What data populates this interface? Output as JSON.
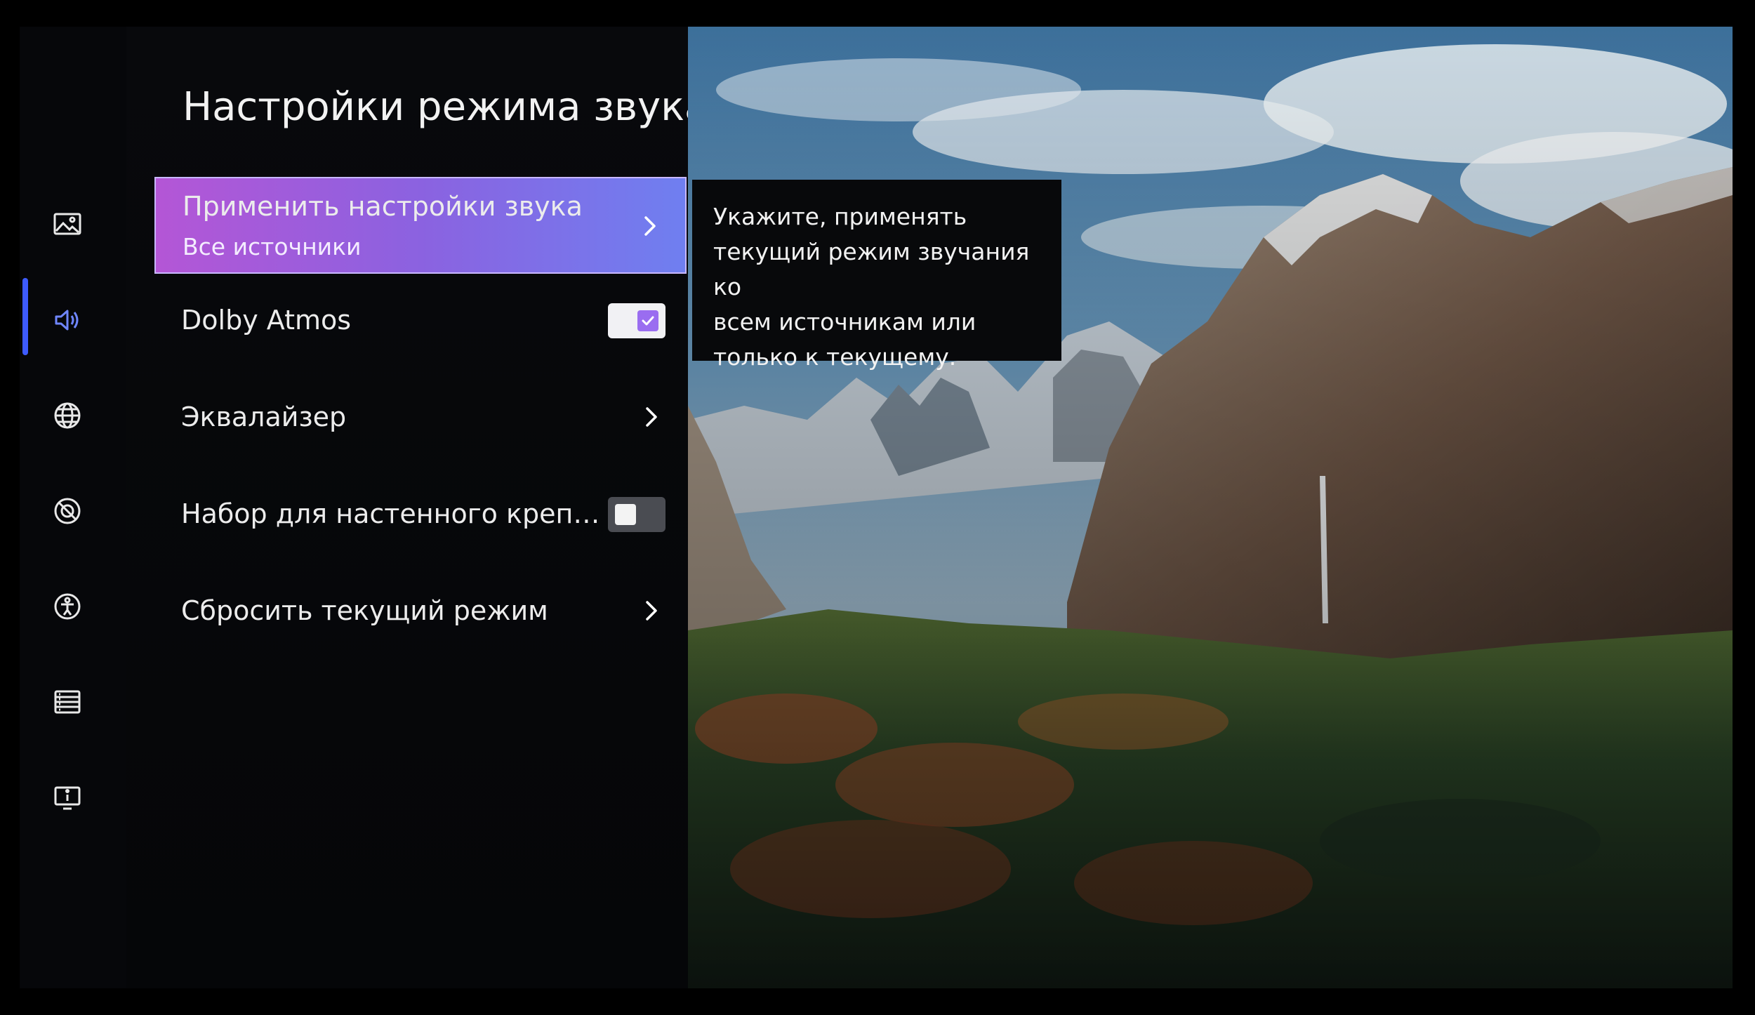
{
  "page_title": "Настройки режима звука",
  "rail": {
    "items": [
      {
        "name": "picture-settings-icon"
      },
      {
        "name": "sound-settings-icon",
        "active": true
      },
      {
        "name": "network-icon"
      },
      {
        "name": "general-settings-icon"
      },
      {
        "name": "accessibility-icon"
      },
      {
        "name": "support-icon"
      },
      {
        "name": "system-info-icon"
      }
    ],
    "accent_color": "#3d5bff"
  },
  "menu": {
    "items": [
      {
        "label": "Применить настройки звука",
        "value": "Все источники",
        "control": "chevron",
        "selected": true
      },
      {
        "label": "Dolby Atmos",
        "control": "toggle",
        "checked": true
      },
      {
        "label": "Эквалайзер",
        "control": "chevron"
      },
      {
        "label": "Набор для настенного крепле…",
        "control": "toggle",
        "checked": false
      },
      {
        "label": "Сбросить текущий режим",
        "control": "chevron"
      }
    ],
    "selected_gradient": [
      "#b456d6",
      "#6f7ff0"
    ]
  },
  "tooltip": {
    "lines": [
      "Укажите, применять",
      "текущий режим звучания ко",
      "всем источникам или",
      "только к текущему."
    ]
  }
}
